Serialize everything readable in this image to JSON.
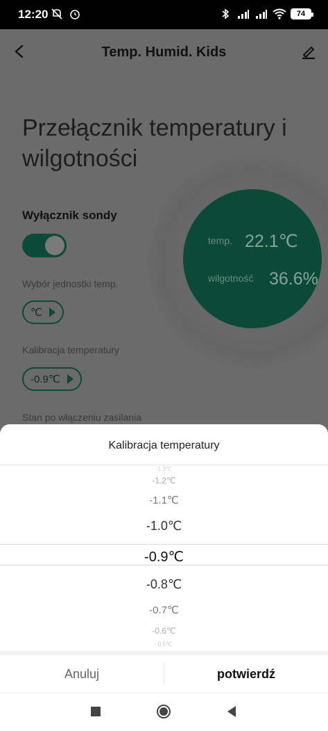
{
  "status_bar": {
    "time": "12:20",
    "battery": "74"
  },
  "header": {
    "title": "Temp. Humid. Kids"
  },
  "main": {
    "title": "Przełącznik temperatury i wilgotności",
    "probe_switch_label": "Wyłącznik sondy",
    "probe_switch_on": true,
    "unit_label": "Wybór jednostki temp.",
    "unit_value": "℃",
    "calibration_label": "Kalibracja temperatury",
    "calibration_value": "-0.9℃",
    "power_on_label": "Stan po włączeniu zasilania"
  },
  "sensor": {
    "temp_label": "temp.",
    "temp_value": "22.1℃",
    "humidity_label": "wilgotność",
    "humidity_value": "36.6%"
  },
  "sheet": {
    "title": "Kalibracja temperatury",
    "options": [
      {
        "label": "-1.3℃"
      },
      {
        "label": "-1.2℃"
      },
      {
        "label": "-1.1℃"
      },
      {
        "label": "-1.0℃"
      },
      {
        "label": "-0.9℃"
      },
      {
        "label": "-0.8℃"
      },
      {
        "label": "-0.7℃"
      },
      {
        "label": "-0.6℃"
      },
      {
        "label": "-0.5℃"
      }
    ],
    "selected": "-0.9℃",
    "cancel_label": "Anuluj",
    "confirm_label": "potwierdź"
  },
  "colors": {
    "accent": "#0b4a36",
    "overlay": "#6b6b6b",
    "sheet_bg": "#ffffff"
  },
  "icons": {
    "status_left": [
      "mute-icon",
      "alarm-icon"
    ],
    "status_right": [
      "bluetooth-icon",
      "signal-icon",
      "signal-icon",
      "wifi-icon"
    ],
    "header": [
      "back-arrow-icon",
      "edit-pencil-icon"
    ],
    "system_nav": [
      "recents-square-icon",
      "home-circle-icon",
      "back-triangle-icon"
    ]
  }
}
